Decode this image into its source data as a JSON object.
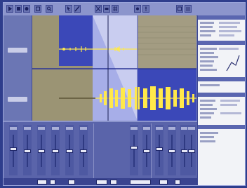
{
  "app": {
    "toolbar_icons": [
      "play-icon",
      "stop-icon",
      "record-icon",
      "loop-icon",
      "zoom-icon",
      "cursor-icon",
      "pencil-icon",
      "scissors-icon",
      "eraser-icon",
      "grid-icon",
      "settings-icon",
      "help-icon"
    ],
    "colors": {
      "background": "#2e3d8c",
      "window": "#6d78b8",
      "wave_view": "#3b48b8",
      "waveform": "#ffe94a",
      "region_gray": "#9b9474",
      "inspector": "#f2f3f7"
    }
  },
  "tracks": [
    {
      "id": "track-1",
      "has_label": true
    },
    {
      "id": "track-2",
      "has_label": true
    }
  ],
  "mixer": {
    "channels": [
      {
        "id": "ch-1",
        "fader_level": 0.55
      },
      {
        "id": "ch-2",
        "fader_level": 0.5
      },
      {
        "id": "ch-3",
        "fader_level": 0.5
      },
      {
        "id": "ch-4",
        "fader_level": 0.5
      },
      {
        "id": "ch-5",
        "fader_level": 0.5
      },
      {
        "id": "ch-6",
        "fader_level": 0.5
      },
      {
        "id": "ch-7",
        "fader_level": 0.6
      },
      {
        "id": "ch-8",
        "fader_level": 0.5
      },
      {
        "id": "ch-9",
        "fader_level": 0.55
      },
      {
        "id": "ch-10",
        "fader_level": 0.5
      },
      {
        "id": "ch-11",
        "fader_level": 0.5
      },
      {
        "id": "ch-12",
        "fader_level": 0.5
      }
    ]
  }
}
